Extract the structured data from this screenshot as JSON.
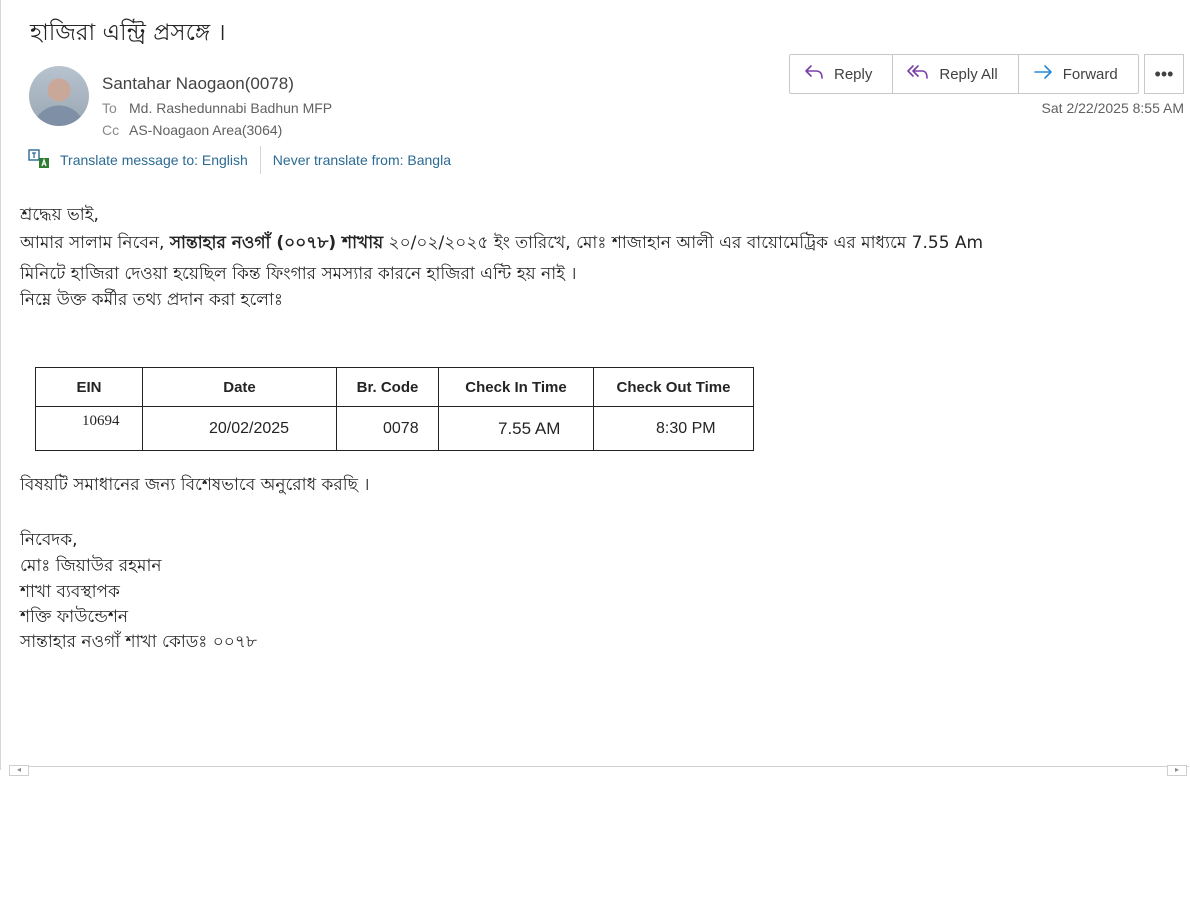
{
  "email": {
    "subject": "হাজিরা এন্ট্রি প্রসঙ্গে ।",
    "sender": "Santahar Naogaon(0078)",
    "to_label": "To",
    "to": "Md. Rashedunnabi Badhun MFP",
    "cc_label": "Cc",
    "cc": "AS-Noagaon Area(3064)",
    "date": "Sat 2/22/2025 8:55 AM"
  },
  "actions": {
    "reply": "Reply",
    "reply_all": "Reply All",
    "forward": "Forward",
    "more": "•••"
  },
  "translate": {
    "to": "Translate message to: English",
    "never": "Never translate from: Bangla"
  },
  "body": {
    "greeting": "শ্রদ্ধেয় ভাই,",
    "line1_a": "আমার সালাম নিবেন, ",
    "line1_bold": "সান্তাহার নওগাঁ (০০৭৮) শাখায়",
    "line1_b": "  ২০/০২/২০২৫ ইং তারিখে,  মোঃ শাজাহান আলী এর    বায়োমেট্রিক এর মাধ্যমে 7.55 Am",
    "line2": "মিনিটে  হাজিরা দেওয়া হয়েছিল কিন্ত ফিংগার সমস্যার কারনে হাজিরা এন্টি হয় নাই ।",
    "line3": "নিম্নে  উক্ত কর্মীর  তথ্য প্রদান করা হলোঃ",
    "request": "বিষয়টি সমাধানের জন্য বিশেষভাবে অনুরোধ করছি ।",
    "sign1": "নিবেদক,",
    "sign2": "মোঃ জিয়াউর রহমান",
    "sign3": "শাখা ব্যবস্থাপক",
    "sign4": "শক্তি ফাউন্ডেশন",
    "sign5": "সান্তাহার নওগাঁ  শাখা কোডঃ ০০৭৮"
  },
  "table": {
    "headers": [
      "EIN",
      "Date",
      "Br. Code",
      "Check In Time",
      "Check Out Time"
    ],
    "row": [
      "10694",
      "20/02/2025",
      "0078",
      "7.55 AM",
      "8:30 PM"
    ]
  },
  "colors": {
    "link": "#2b6a94",
    "icon_accent": "#7a3fa8",
    "forward_icon": "#2b88d8"
  }
}
